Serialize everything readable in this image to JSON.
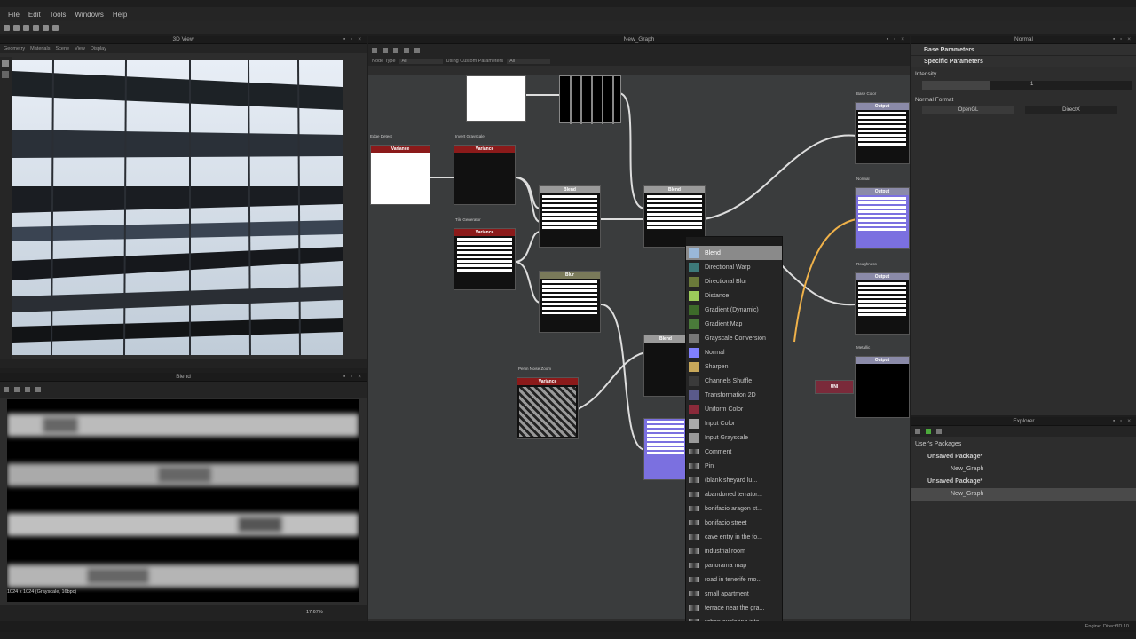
{
  "menubar": {
    "items": [
      "File",
      "Edit",
      "Tools",
      "Windows",
      "Help"
    ]
  },
  "view3d": {
    "title": "3D View",
    "toolbar": [
      "Geometry",
      "Materials",
      "Scene",
      "View",
      "Display"
    ]
  },
  "blend_preview": {
    "title": "Blend",
    "info": "1024 x 1024 (Grayscale, 16bpc)",
    "zoom": "17.67%"
  },
  "graph": {
    "title": "New_Graph",
    "filter_label": "Node Type",
    "filter_value": "All",
    "custom_label": "Using Custom Parameters",
    "custom_value": "All",
    "node_labels": {
      "edge_detect": "Edge Detect",
      "invert_grayscale": "Invert Grayscale",
      "tile_generator": "Tile Generator",
      "perlin_noise_zoom": "Perlin Noise Zoom",
      "base_color": "Base Color",
      "normal": "Normal",
      "roughness": "Roughness",
      "metallic": "Metallic"
    },
    "headers": {
      "variance": "Variance",
      "blend": "Blend",
      "blur": "Blur",
      "output": "Output",
      "uniform": "UNI"
    }
  },
  "context_menu": {
    "items": [
      {
        "label": "Blend",
        "color": "#9ab8d8"
      },
      {
        "label": "Directional Warp",
        "color": "#3d7a7a"
      },
      {
        "label": "Directional Blur",
        "color": "#6b7a3a"
      },
      {
        "label": "Distance",
        "color": "#9ccc5a"
      },
      {
        "label": "Gradient (Dynamic)",
        "color": "#3d6a2a"
      },
      {
        "label": "Gradient Map",
        "color": "#4a7a3a"
      },
      {
        "label": "Grayscale Conversion",
        "color": "#777777"
      },
      {
        "label": "Normal",
        "color": "#8080ff"
      },
      {
        "label": "Sharpen",
        "color": "#c8a85a"
      },
      {
        "label": "Channels Shuffle",
        "color": "#3a3a3a"
      },
      {
        "label": "Transformation 2D",
        "color": "#5a5a8a"
      },
      {
        "label": "Uniform Color",
        "color": "#8a2a3a"
      },
      {
        "label": "Input Color",
        "color": "#aaaaaa"
      },
      {
        "label": "Input Grayscale",
        "color": "#999999"
      },
      {
        "label": "Comment",
        "color": ""
      },
      {
        "label": "Pin",
        "color": ""
      },
      {
        "label": "(blank sheyard lu...",
        "color": ""
      },
      {
        "label": "abandoned terrator...",
        "color": ""
      },
      {
        "label": "bonifacio aragon st...",
        "color": ""
      },
      {
        "label": "bonifacio street",
        "color": ""
      },
      {
        "label": "cave entry in the fo...",
        "color": ""
      },
      {
        "label": "industrial room",
        "color": ""
      },
      {
        "label": "panorama map",
        "color": ""
      },
      {
        "label": "road in tenerife mo...",
        "color": ""
      },
      {
        "label": "small apartment",
        "color": ""
      },
      {
        "label": "terrace near the gra...",
        "color": ""
      },
      {
        "label": "urban exploring inte...",
        "color": ""
      }
    ]
  },
  "properties": {
    "title": "Normal",
    "base_params": "Base Parameters",
    "specific_params": "Specific Parameters",
    "intensity_label": "Intensity",
    "intensity_value": "1",
    "format_label": "Normal Format",
    "opengl": "OpenGL",
    "directx": "DirectX"
  },
  "explorer": {
    "title": "Explorer",
    "packages_label": "User's Packages",
    "items": [
      {
        "label": "Unsaved Package*",
        "level": 1
      },
      {
        "label": "New_Graph",
        "level": 2
      },
      {
        "label": "Unsaved Package*",
        "level": 1
      },
      {
        "label": "New_Graph",
        "level": 2
      }
    ]
  },
  "status": {
    "engine": "Engine: Direct3D 10"
  },
  "colors": {
    "variance": "#8b1a1a",
    "blend": "#9a9a9a",
    "blur": "#7a7a5a",
    "output": "#8a8aa8",
    "normal_node": "#7b70e0"
  }
}
